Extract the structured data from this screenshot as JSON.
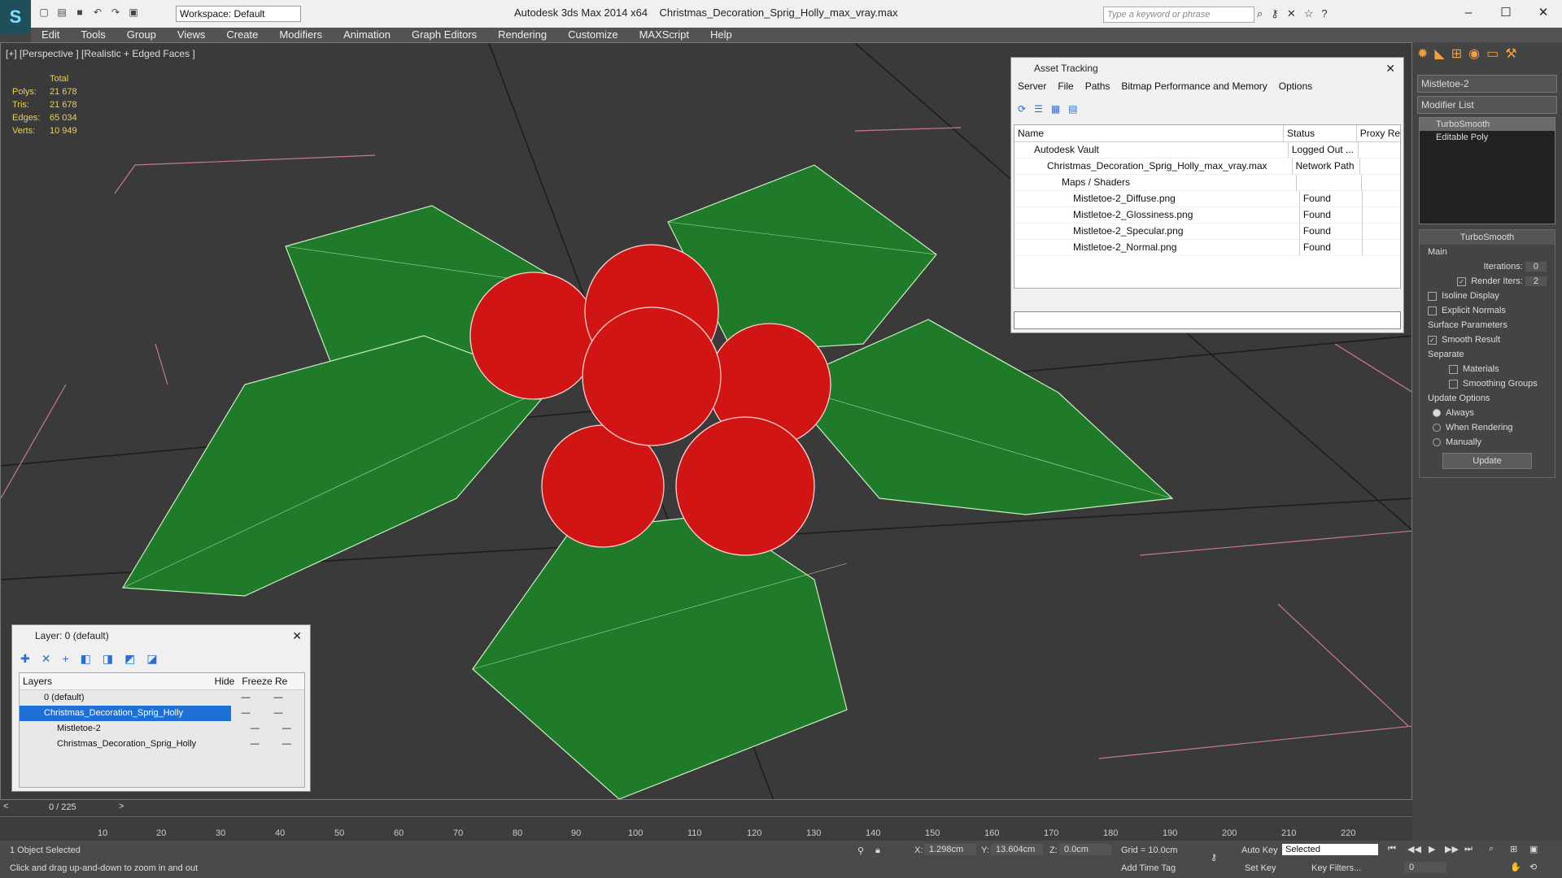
{
  "app": {
    "title_left": "Autodesk 3ds Max  2014 x64",
    "title_file": "Christmas_Decoration_Sprig_Holly_max_vray.max",
    "workspace": "Workspace: Default",
    "search_placeholder": "Type a keyword or phrase"
  },
  "menu": [
    "Edit",
    "Tools",
    "Group",
    "Views",
    "Create",
    "Modifiers",
    "Animation",
    "Graph Editors",
    "Rendering",
    "Customize",
    "MAXScript",
    "Help"
  ],
  "viewport": {
    "label": "[+] [Perspective ] [Realistic + Edged Faces ]",
    "stats_header": "Total",
    "stats": [
      {
        "k": "Polys:",
        "v": "21 678"
      },
      {
        "k": "Tris:",
        "v": "21 678"
      },
      {
        "k": "Edges:",
        "v": "65 034"
      },
      {
        "k": "Verts:",
        "v": "10 949"
      }
    ]
  },
  "asset_tracking": {
    "title": "Asset Tracking",
    "menu": [
      "Server",
      "File",
      "Paths",
      "Bitmap Performance and Memory",
      "Options"
    ],
    "columns": [
      "Name",
      "Status",
      "Proxy Res"
    ],
    "rows": [
      {
        "name": "Autodesk Vault",
        "status": "Logged Out ...",
        "indent": 1
      },
      {
        "name": "Christmas_Decoration_Sprig_Holly_max_vray.max",
        "status": "Network Path",
        "indent": 2
      },
      {
        "name": "Maps / Shaders",
        "status": "",
        "indent": 3
      },
      {
        "name": "Mistletoe-2_Diffuse.png",
        "status": "Found",
        "indent": 4
      },
      {
        "name": "Mistletoe-2_Glossiness.png",
        "status": "Found",
        "indent": 4
      },
      {
        "name": "Mistletoe-2_Specular.png",
        "status": "Found",
        "indent": 4
      },
      {
        "name": "Mistletoe-2_Normal.png",
        "status": "Found",
        "indent": 4
      }
    ]
  },
  "layers": {
    "title": "Layer: 0 (default)",
    "columns": [
      "Layers",
      "Hide",
      "Freeze",
      "Re"
    ],
    "rows": [
      {
        "name": "0 (default)",
        "indent": 1
      },
      {
        "name": "Christmas_Decoration_Sprig_Holly",
        "indent": 1
      },
      {
        "name": "Mistletoe-2",
        "indent": 2
      },
      {
        "name": "Christmas_Decoration_Sprig_Holly",
        "indent": 2
      }
    ]
  },
  "command_panel": {
    "object_name": "Mistletoe-2",
    "modifier_list": "Modifier List",
    "stack": [
      "TurboSmooth",
      "Editable Poly"
    ],
    "turbosmooth": {
      "title": "TurboSmooth",
      "main": "Main",
      "iterations_label": "Iterations:",
      "iterations": "0",
      "render_iters_label": "Render Iters:",
      "render_iters": "2",
      "isoline": "Isoline Display",
      "explicit": "Explicit Normals",
      "surface_params": "Surface Parameters",
      "smooth_result": "Smooth Result",
      "separate": "Separate",
      "materials": "Materials",
      "smoothing_groups": "Smoothing Groups",
      "update_options": "Update Options",
      "always": "Always",
      "when_rendering": "When Rendering",
      "manually": "Manually",
      "update": "Update"
    }
  },
  "timeline": {
    "frame": "0 / 225",
    "ticks": [
      "10",
      "20",
      "30",
      "40",
      "50",
      "60",
      "70",
      "80",
      "90",
      "100",
      "110",
      "120",
      "130",
      "140",
      "150",
      "160",
      "170",
      "180",
      "190",
      "200",
      "210",
      "220"
    ]
  },
  "status": {
    "selected": "1 Object Selected",
    "prompt": "Click and drag up-and-down to zoom in and out",
    "x": "1.298cm",
    "y": "13.604cm",
    "z": "0.0cm",
    "grid": "Grid = 10.0cm",
    "auto_key": "Auto Key",
    "set_key": "Set Key",
    "selected_dd": "Selected",
    "key_filters": "Key Filters...",
    "add_time_tag": "Add Time Tag",
    "frame_field": "0"
  }
}
